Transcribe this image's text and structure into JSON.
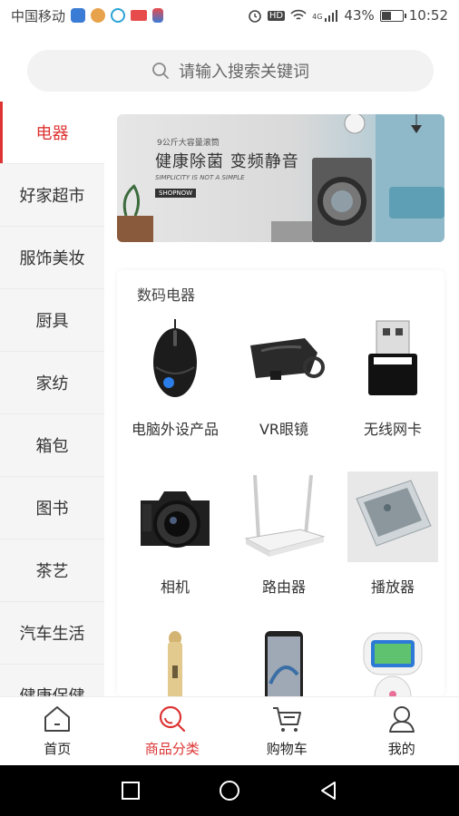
{
  "status_bar": {
    "carrier": "中国移动",
    "network": "4G",
    "hd": "HD",
    "battery": "43%",
    "battery_level": 0.43,
    "time": "10:52"
  },
  "search": {
    "placeholder": "请输入搜索关键词"
  },
  "sidebar": {
    "items": [
      {
        "label": "电器",
        "active": true
      },
      {
        "label": "好家超市"
      },
      {
        "label": "服饰美妆"
      },
      {
        "label": "厨具"
      },
      {
        "label": "家纺"
      },
      {
        "label": "箱包"
      },
      {
        "label": "图书"
      },
      {
        "label": "茶艺"
      },
      {
        "label": "汽车生活"
      },
      {
        "label": "健康保健"
      }
    ]
  },
  "banner": {
    "small_text": "9公斤大容量滚筒",
    "title": "健康除菌 变频静音",
    "subtitle": "SIMPLICITY IS NOT A SIMPLE",
    "shop": "SHOPNOW"
  },
  "section": {
    "title": "数码电器",
    "products": [
      {
        "label": "电脑外设产品",
        "icon": "mouse-icon"
      },
      {
        "label": "VR眼镜",
        "icon": "vr-headset-icon"
      },
      {
        "label": "无线网卡",
        "icon": "usb-wifi-adapter-icon"
      },
      {
        "label": "相机",
        "icon": "camera-icon"
      },
      {
        "label": "路由器",
        "icon": "router-icon"
      },
      {
        "label": "播放器",
        "icon": "media-player-icon"
      },
      {
        "label": "",
        "icon": "microphone-icon"
      },
      {
        "label": "",
        "icon": "phone-icon"
      },
      {
        "label": "",
        "icon": "robot-icon"
      }
    ]
  },
  "tabbar": {
    "tabs": [
      {
        "label": "首页",
        "icon": "home-icon"
      },
      {
        "label": "商品分类",
        "icon": "category-search-icon",
        "active": true
      },
      {
        "label": "购物车",
        "icon": "cart-icon"
      },
      {
        "label": "我的",
        "icon": "user-icon"
      }
    ]
  },
  "colors": {
    "accent": "#dd3333",
    "sidebar_bg": "#f5f5f5"
  }
}
